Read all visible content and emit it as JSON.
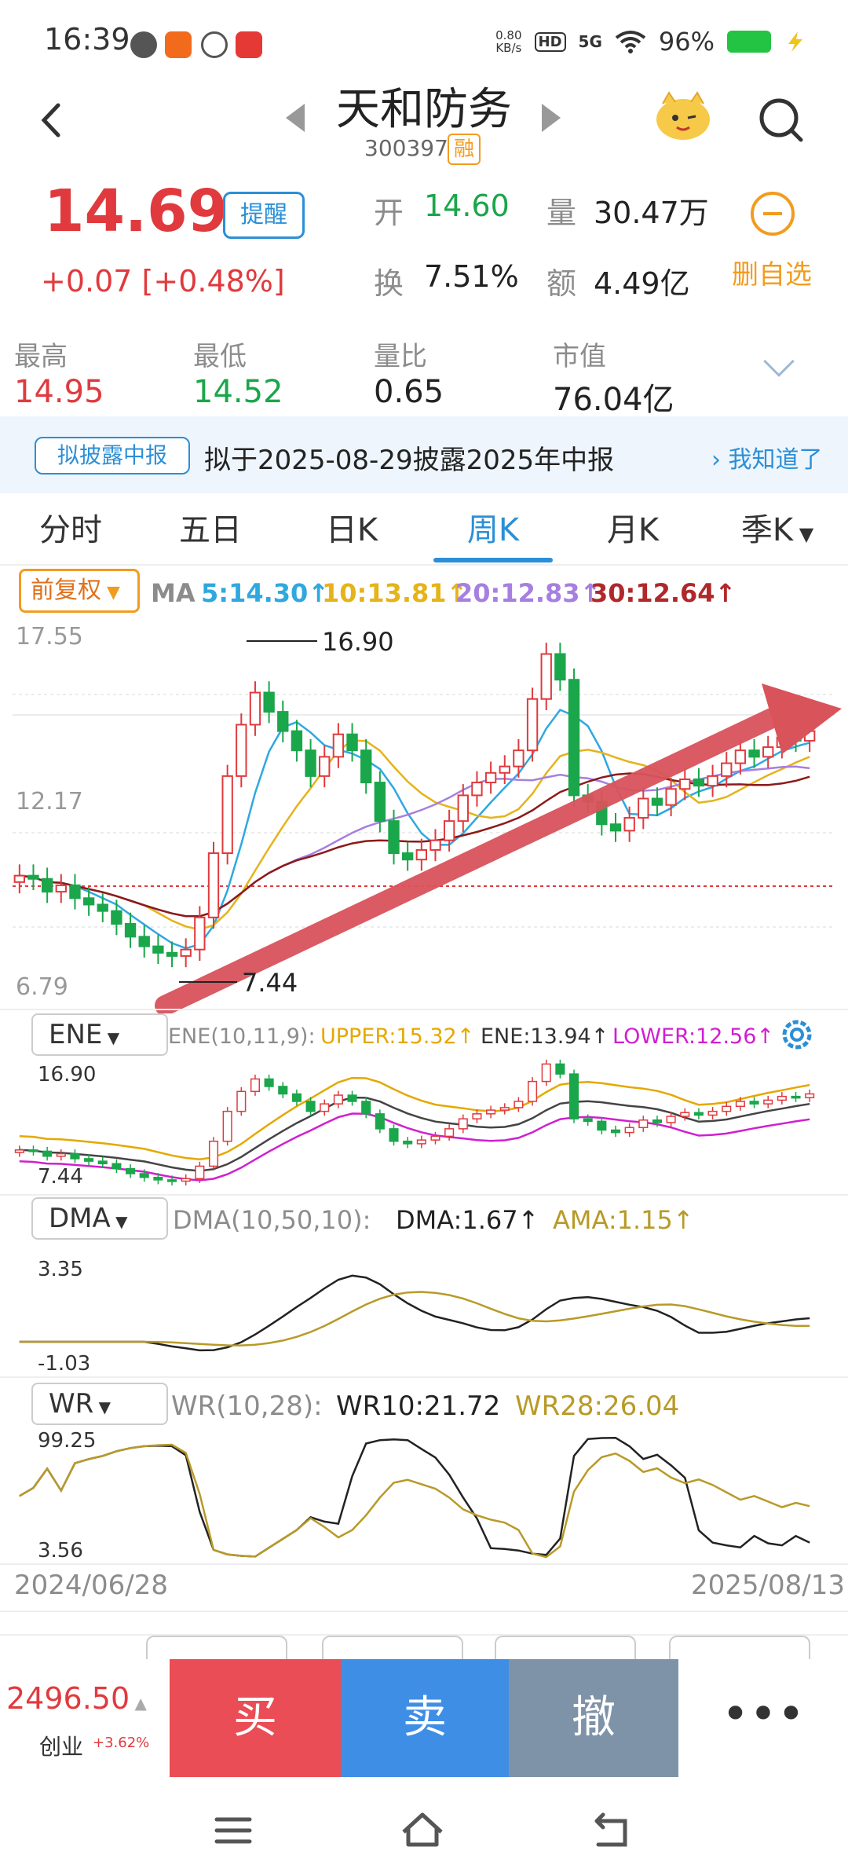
{
  "status_bar": {
    "time": "16:39",
    "net_speed_value": "0.80",
    "net_speed_unit": "KB/s",
    "hd": "HD",
    "network": "5G",
    "battery": "96%",
    "app_icons": [
      "wechat-icon",
      "app-icon",
      "app-icon",
      "toutiao-icon"
    ]
  },
  "header": {
    "name": "天和防务",
    "code": "300397",
    "margin_badge": "融"
  },
  "quote": {
    "price": "14.69",
    "alert_label": "提醒",
    "change": "+0.07  [+0.48%]",
    "open_label": "开",
    "open_value": "14.60",
    "volume_label": "量",
    "volume_value": "30.47万",
    "turnover_label": "换",
    "turnover_value": "7.51%",
    "amount_label": "额",
    "amount_value": "4.49亿",
    "remove_fav_label": "删自选"
  },
  "stats": {
    "high_label": "最高",
    "high_value": "14.95",
    "low_label": "最低",
    "low_value": "14.52",
    "vol_ratio_label": "量比",
    "vol_ratio_value": "0.65",
    "mkt_cap_label": "市值",
    "mkt_cap_value": "76.04亿"
  },
  "notice": {
    "tag": "拟披露中报",
    "text": "拟于2025-08-29披露2025年中报",
    "ack": "我知道了"
  },
  "tabs": [
    "分时",
    "五日",
    "日K",
    "周K",
    "月K",
    "季K"
  ],
  "active_tab": "周K",
  "ma_legend": {
    "adjust": "前复权",
    "ma_label": "MA",
    "ma5": "5:14.30",
    "ma10": "10:13.81",
    "ma20": "20:12.83",
    "ma30": "30:12.64"
  },
  "colors": {
    "up": "#e03a3e",
    "down": "#1aa64a",
    "ma5": "#2fa8e0",
    "ma10": "#e5b31a",
    "ma20": "#a77fe0",
    "ma30": "#8b1a1a",
    "accent": "#2c8fd6"
  },
  "main_chart": {
    "y_high_label": "17.55",
    "y_mid_label": "12.17",
    "y_low_label": "6.79",
    "max_annotation": "16.90",
    "min_annotation": "7.44"
  },
  "ene": {
    "button": "ENE",
    "params": "ENE(10,11,9):",
    "upper": "UPPER:15.32",
    "ene": "ENE:13.94",
    "lower": "LOWER:12.56",
    "y_high": "16.90",
    "y_low": "7.44"
  },
  "dma": {
    "button": "DMA",
    "params": "DMA(10,50,10):",
    "dma": "DMA:1.67",
    "ama": "AMA:1.15",
    "y_high": "3.35",
    "y_low": "-1.03"
  },
  "wr": {
    "button": "WR",
    "params": "WR(10,28):",
    "wr10": "WR10:21.72",
    "wr28": "WR28:26.04",
    "y_high": "99.25",
    "y_low": "3.56"
  },
  "date_range": {
    "start": "2024/06/28",
    "end": "2025/08/13"
  },
  "bottom": {
    "index_value": "2496.50",
    "index_name": "创业",
    "index_pct": "+3.62%",
    "buy": "买",
    "sell": "卖",
    "cancel": "撤",
    "more": "•••"
  }
}
